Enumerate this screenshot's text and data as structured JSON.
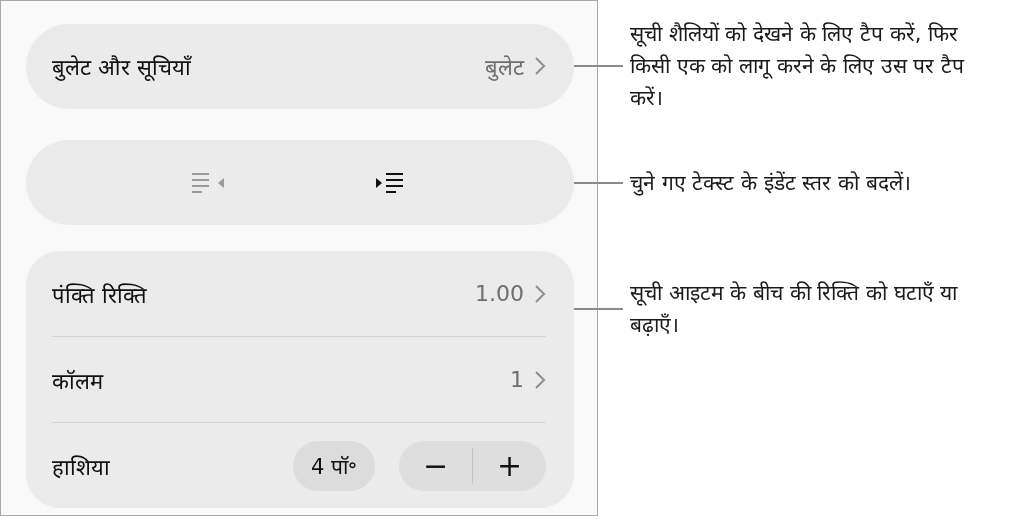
{
  "sections": [
    {
      "kind": "link",
      "label": "बुलेट और सूचियाँ",
      "value": "बुलेट",
      "callout": "सूची शैलियों को देखने के लिए टैप करें, फिर किसी एक को लागू करने के लिए उस पर टैप करें।"
    },
    {
      "kind": "indent",
      "outdent_disabled": true,
      "indent_disabled": false,
      "callout": "चुने गए टेक्स्ट के इंडेंट स्तर को बदलें।"
    },
    {
      "kind": "group",
      "callout": "सूची आइटम के बीच की रिक्ति को घटाएँ या बढ़ाएँ।",
      "rows": [
        {
          "kind": "link",
          "label": "पंक्ति रिक्ति",
          "value": "1.00"
        },
        {
          "kind": "link",
          "label": "कॉलम",
          "value": "1"
        },
        {
          "kind": "stepper",
          "label": "हाशिया",
          "value": "4 पॉ॰",
          "minus": "−",
          "plus": "+"
        }
      ]
    }
  ]
}
